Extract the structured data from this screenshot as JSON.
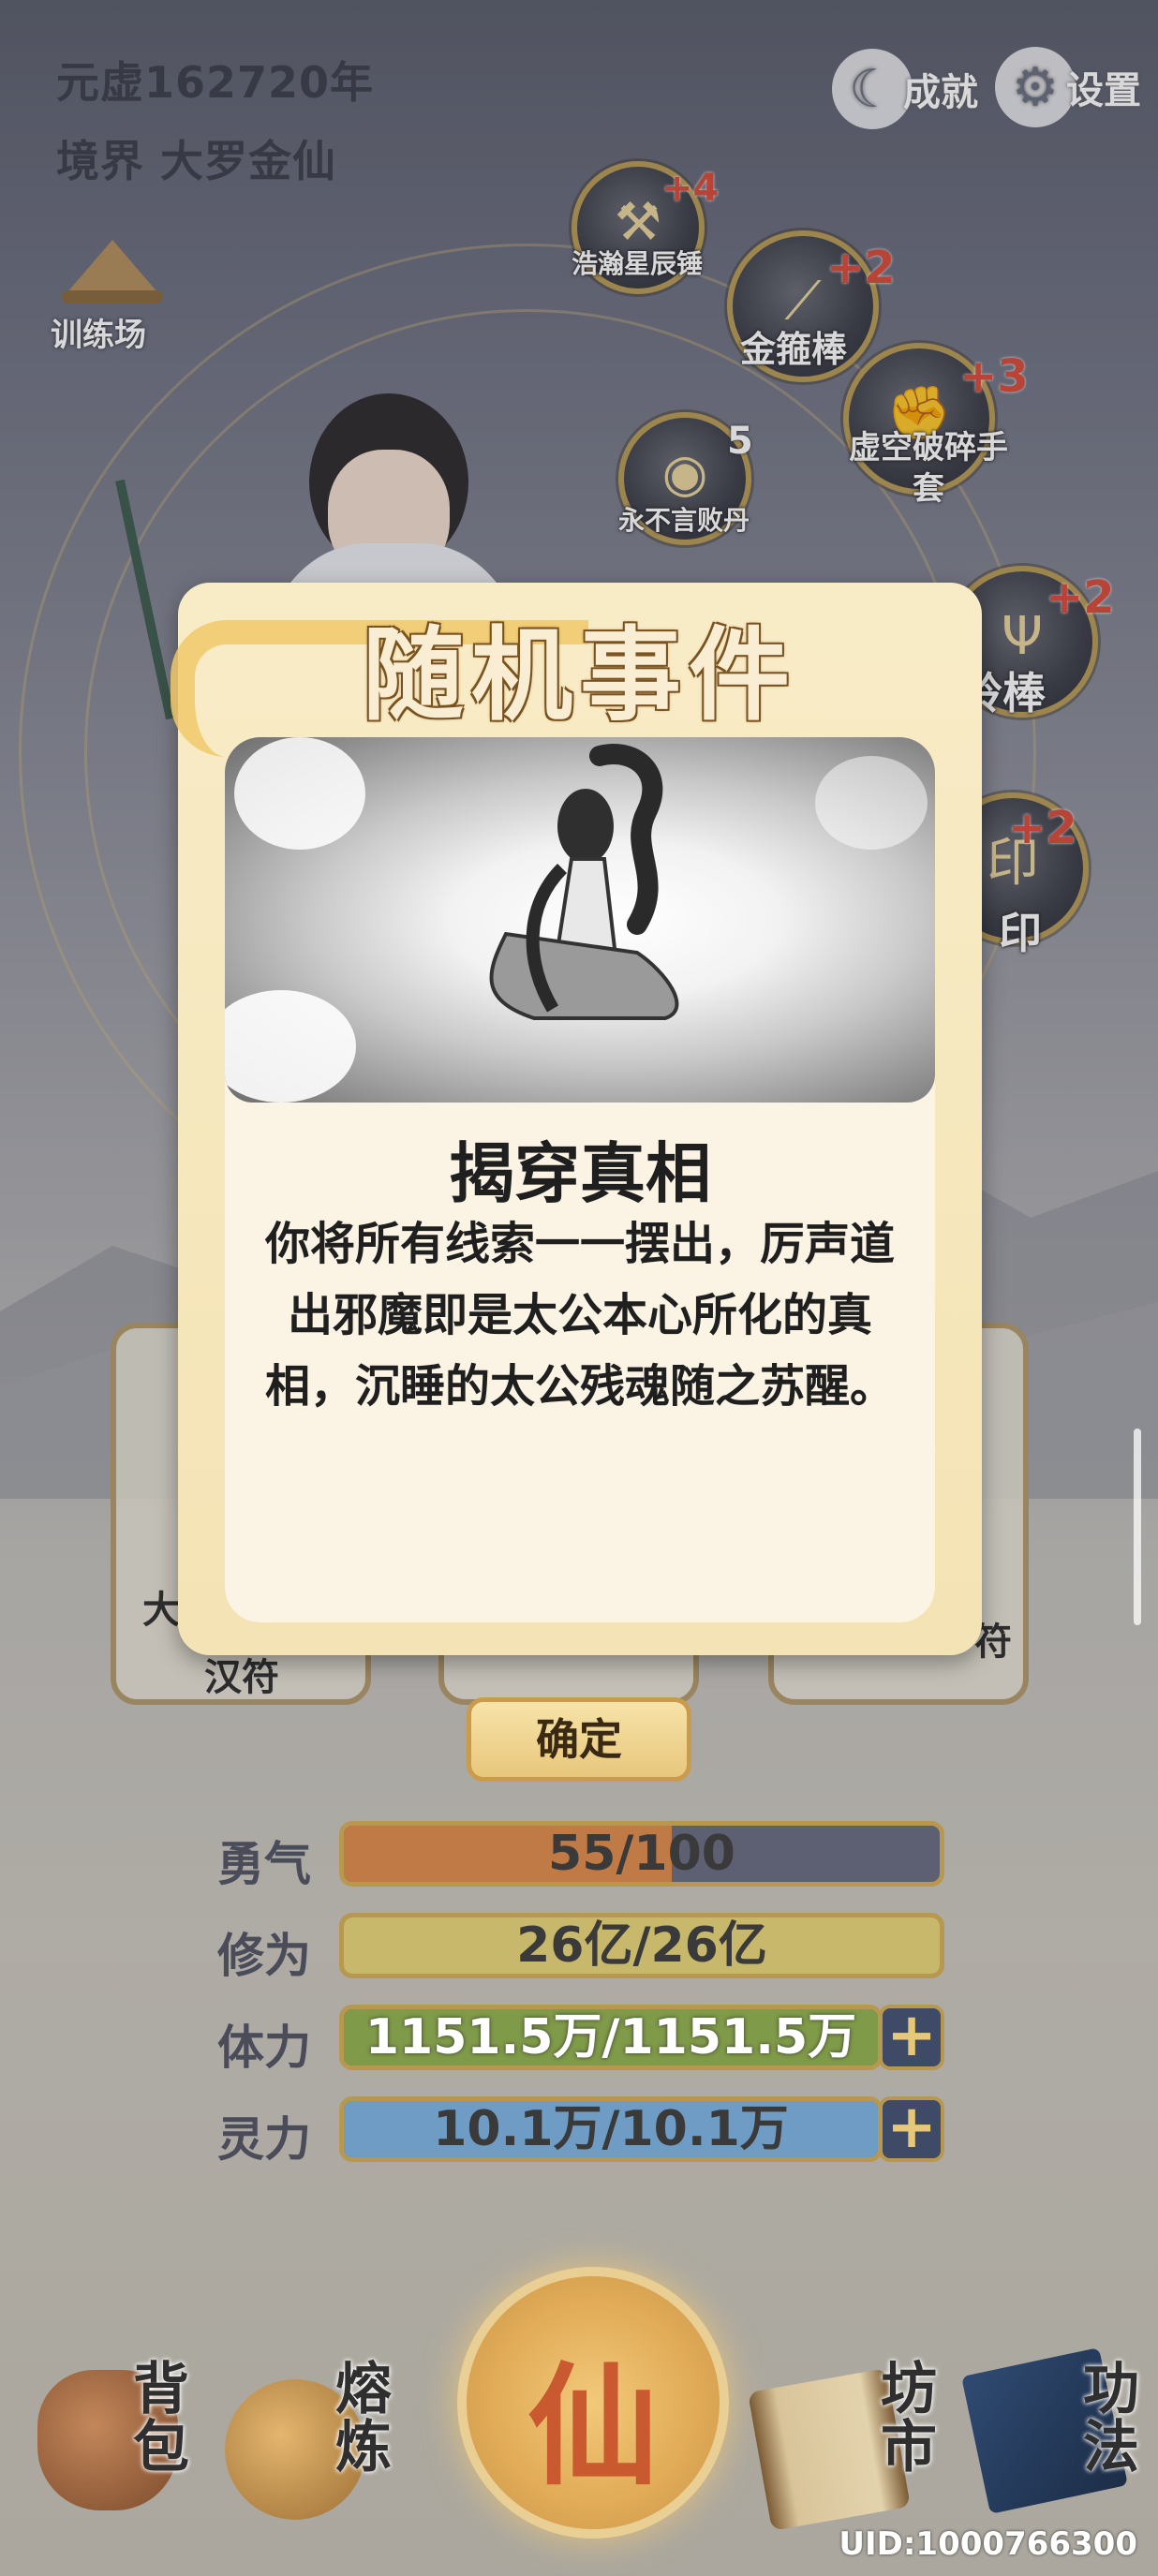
{
  "header": {
    "era": "元虚162720年",
    "realm": "境界 大罗金仙",
    "achievements_label": "成就",
    "settings_label": "设置",
    "training_label": "训练场"
  },
  "equipment": [
    {
      "name": "浩瀚星辰锤",
      "level": "+4",
      "icon": "hammer-icon"
    },
    {
      "name": "金箍棒",
      "level": "+2",
      "icon": "staff-icon"
    },
    {
      "name": "虚空破碎手套",
      "level": "+3",
      "icon": "gauntlet-icon"
    },
    {
      "name": "永不言败丹",
      "level": "5",
      "icon": "pill-icon"
    },
    {
      "name": "铃棒",
      "level": "+2",
      "icon": "trident-icon"
    },
    {
      "name": "印",
      "level": "+2",
      "icon": "seal-icon"
    }
  ],
  "background_cards": [
    {
      "label": "大"
    },
    {
      "label": "汉符"
    },
    {
      "label": "符"
    }
  ],
  "event": {
    "header": "随机事件",
    "title": "揭穿真相",
    "description": "你将所有线索一一摆出，厉声道出邪魔即是太公本心所化的真相，沉睡的太公残魂随之苏醒。",
    "confirm_label": "确定"
  },
  "stats": [
    {
      "label": "勇气",
      "value_text": "55/100",
      "fraction": 0.55,
      "color": "#c07a45"
    },
    {
      "label": "修为",
      "value_text": "26亿/26亿",
      "fraction": 1.0,
      "color": "#c8b86b"
    },
    {
      "label": "体力",
      "value_text": "1151.5万/1151.5万",
      "fraction": 1.0,
      "color": "#7f9a48"
    },
    {
      "label": "灵力",
      "value_text": "10.1万/10.1万",
      "fraction": 1.0,
      "color": "#6e9cc4"
    }
  ],
  "nav": {
    "bag": "背包",
    "smelt": "熔炼",
    "center": "仙",
    "market": "坊市",
    "skills": "功法"
  },
  "uid": "UID:1000766300"
}
